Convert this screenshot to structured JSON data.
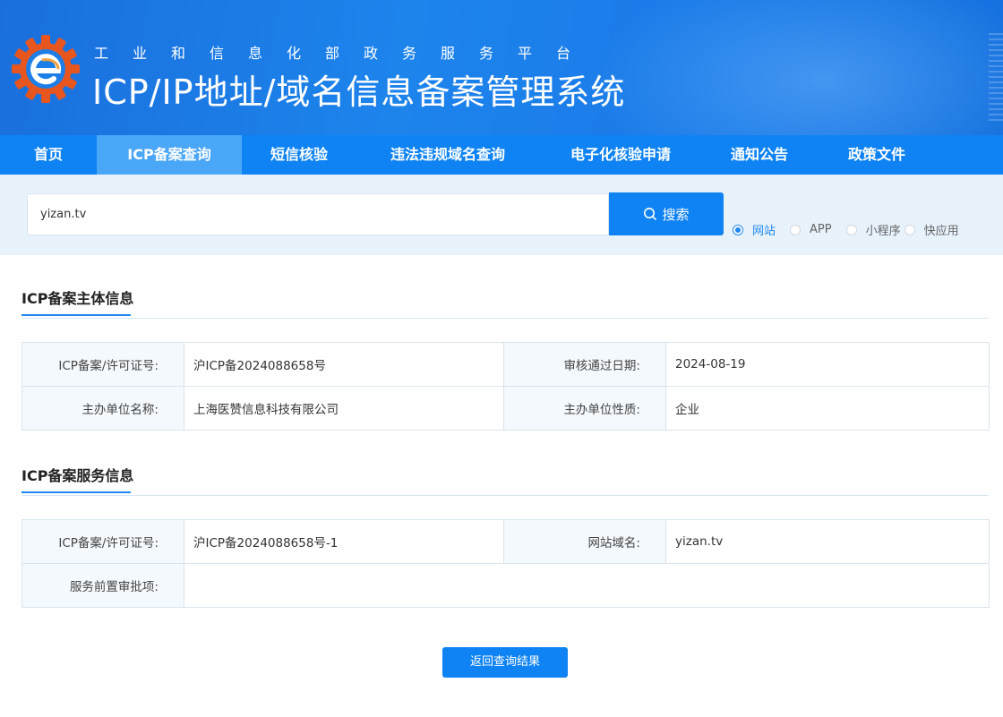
{
  "header": {
    "subtitle": "工业和信息化部政务服务平台",
    "title": "ICP/IP地址/域名信息备案管理系统"
  },
  "nav": [
    {
      "label": "首页",
      "active": false
    },
    {
      "label": "ICP备案查询",
      "active": true
    },
    {
      "label": "短信核验",
      "active": false
    },
    {
      "label": "违法违规域名查询",
      "active": false
    },
    {
      "label": "电子化核验申请",
      "active": false
    },
    {
      "label": "通知公告",
      "active": false
    },
    {
      "label": "政策文件",
      "active": false
    }
  ],
  "search": {
    "value": "yizan.tv",
    "button_label": "搜索",
    "options": [
      {
        "label": "网站",
        "checked": true
      },
      {
        "label": "APP",
        "checked": false
      },
      {
        "label": "小程序",
        "checked": false
      },
      {
        "label": "快应用",
        "checked": false
      }
    ]
  },
  "subject": {
    "title": "ICP备案主体信息",
    "license_label": "ICP备案/许可证号:",
    "license_value": "沪ICP备2024088658号",
    "date_label": "审核通过日期:",
    "date_value": "2024-08-19",
    "org_label": "主办单位名称:",
    "org_value": "上海医赞信息科技有限公司",
    "nature_label": "主办单位性质:",
    "nature_value": "企业"
  },
  "service": {
    "title": "ICP备案服务信息",
    "license_label": "ICP备案/许可证号:",
    "license_value": "沪ICP备2024088658号-1",
    "domain_label": "网站域名:",
    "domain_value": "yizan.tv",
    "approval_label": "服务前置审批项:",
    "approval_value": ""
  },
  "back_button_label": "返回查询结果",
  "colors": {
    "primary": "#0f83f3",
    "nav_active": "#4aa6f7",
    "search_strip": "#e8f2fb",
    "label_cell": "#f4f9fd",
    "logo_orange": "#e8561f"
  }
}
